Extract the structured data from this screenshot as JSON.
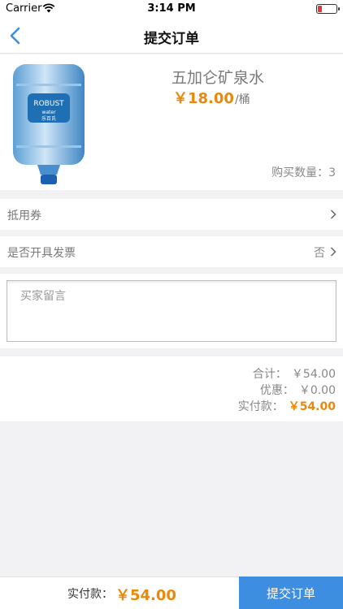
{
  "status_bar": {
    "carrier": "Carrier",
    "time": "3:14 PM",
    "battery_level": 0.2,
    "battery_color": "#e03a3a"
  },
  "nav": {
    "title": "提交订单",
    "back_icon": "chevron-left-icon"
  },
  "product": {
    "name": "五加仑矿泉水",
    "price": "￥18.00",
    "unit": "/桶",
    "quantity": "购买数量：3",
    "image_label": "ROBUST water 乐百氏"
  },
  "options": {
    "coupon_label": "抵用券",
    "invoice_label": "是否开具发票",
    "invoice_value": "否"
  },
  "message": {
    "placeholder": "买家留言",
    "value": ""
  },
  "summary": {
    "total_label": "合计：",
    "total_value": "￥54.00",
    "discount_label": "优惠：",
    "discount_value": "￥0.00",
    "pay_label": "实付款：",
    "pay_value": "￥54.00"
  },
  "bottom_bar": {
    "pay_label": "实付款：",
    "pay_amount": "￥54.00",
    "submit_label": "提交订单"
  },
  "colors": {
    "accent": "#3d8ee0",
    "price": "#e8890c"
  }
}
